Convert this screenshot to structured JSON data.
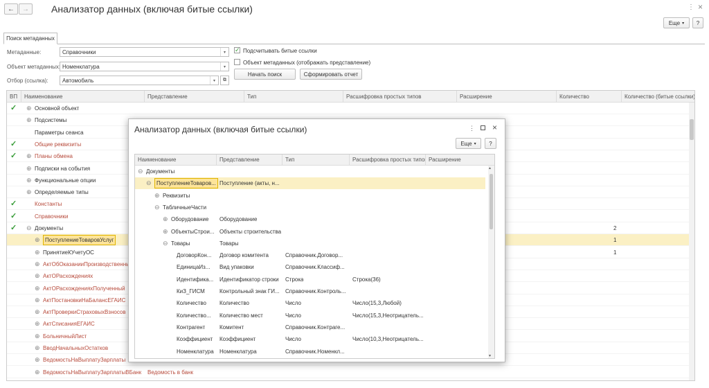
{
  "window": {
    "title": "Анализатор данных (включая битые ссылки)",
    "more_label": "Еще",
    "help_label": "?",
    "back_arrow": "←",
    "forward_arrow": "→",
    "dots": "⋮",
    "close": "×"
  },
  "tab": {
    "label": "Поиск метаданных"
  },
  "form": {
    "metadata_label": "Метаданные:",
    "metadata_value": "Справочники",
    "object_label": "Объект метаданных:",
    "object_value": "Номенклатура",
    "filter_label": "Отбор (ссылка):",
    "filter_value": "Автомобиль",
    "count_broken_label": "Подсчитывать битые ссылки",
    "count_broken_checked": true,
    "metadata_object_label": "Объект метаданных (отображать представление)",
    "metadata_object_checked": false,
    "search_button": "Начать поиск",
    "report_button": "Сформировать отчет"
  },
  "grid": {
    "headers": [
      "ВП",
      "Наименование",
      "Представление",
      "Тип",
      "Расшифровка простых типов",
      "Расширение",
      "Количество",
      "Количество (битые ссылки)"
    ],
    "rows": [
      {
        "check": true,
        "expander": "⊕",
        "indent": 1,
        "name": "Основной объект",
        "red": false,
        "count": ""
      },
      {
        "check": false,
        "expander": "⊕",
        "indent": 1,
        "name": "Подсистемы",
        "red": false,
        "count": ""
      },
      {
        "check": false,
        "expander": "",
        "indent": 1,
        "name": "Параметры сеанса",
        "red": false,
        "count": ""
      },
      {
        "check": true,
        "expander": "",
        "indent": 1,
        "name": "Общие реквизиты",
        "red": true,
        "count": ""
      },
      {
        "check": true,
        "expander": "⊕",
        "indent": 1,
        "name": "Планы обмена",
        "red": true,
        "count": ""
      },
      {
        "check": false,
        "expander": "⊕",
        "indent": 1,
        "name": "Подписки на события",
        "red": false,
        "count": ""
      },
      {
        "check": false,
        "expander": "⊕",
        "indent": 1,
        "name": "Функциональные опции",
        "red": false,
        "count": ""
      },
      {
        "check": false,
        "expander": "⊕",
        "indent": 1,
        "name": "Определяемые типы",
        "red": false,
        "count": ""
      },
      {
        "check": true,
        "expander": "",
        "indent": 1,
        "name": "Константы",
        "red": true,
        "count": ""
      },
      {
        "check": true,
        "expander": "",
        "indent": 1,
        "name": "Справочники",
        "red": true,
        "count": ""
      },
      {
        "check": true,
        "expander": "⊖",
        "indent": 1,
        "name": "Документы",
        "red": false,
        "count": "2"
      },
      {
        "check": false,
        "expander": "⊕",
        "indent": 2,
        "name": "ПоступлениеТоваровУслуг",
        "red": false,
        "count": "1",
        "selected": true
      },
      {
        "check": false,
        "expander": "⊕",
        "indent": 2,
        "name": "ПринятиеКУчетуОС",
        "red": false,
        "count": "1"
      },
      {
        "check": false,
        "expander": "⊕",
        "indent": 2,
        "name": "АктОбОказанииПроизводственныхУслуг",
        "red": true,
        "count": ""
      },
      {
        "check": false,
        "expander": "⊕",
        "indent": 2,
        "name": "АктОРасхождениях",
        "red": true,
        "count": ""
      },
      {
        "check": false,
        "expander": "⊕",
        "indent": 2,
        "name": "АктОРасхожденияхПолученный",
        "red": true,
        "count": ""
      },
      {
        "check": false,
        "expander": "⊕",
        "indent": 2,
        "name": "АктПостановкиНаБалансЕГАИС",
        "red": true,
        "count": ""
      },
      {
        "check": false,
        "expander": "⊕",
        "indent": 2,
        "name": "АктПроверкиСтраховыхВзносов",
        "red": true,
        "count": ""
      },
      {
        "check": false,
        "expander": "⊕",
        "indent": 2,
        "name": "АктСписанияЕГАИС",
        "red": true,
        "count": ""
      },
      {
        "check": false,
        "expander": "⊕",
        "indent": 2,
        "name": "БольничныйЛист",
        "red": true,
        "count": ""
      },
      {
        "check": false,
        "expander": "⊕",
        "indent": 2,
        "name": "ВводНачальныхОстатков",
        "red": true,
        "count": ""
      },
      {
        "check": false,
        "expander": "⊕",
        "indent": 2,
        "name": "ВедомостьНаВыплатуЗарплаты",
        "red": true,
        "count": ""
      },
      {
        "check": false,
        "expander": "⊕",
        "indent": 2,
        "name": "ВедомостьНаВыплатуЗарплатыВБанк",
        "red": true,
        "count": "",
        "repr": "Ведомость в банк"
      }
    ]
  },
  "modal": {
    "title": "Анализатор данных (включая битые ссылки)",
    "more_label": "Еще",
    "help_label": "?",
    "headers": [
      "Наименование",
      "Представление",
      "Тип",
      "Расшифровка простых типов",
      "Расширение"
    ],
    "rows": [
      {
        "expander": "⊖",
        "indent": 0,
        "name": "Документы",
        "repr": "",
        "type": "",
        "decode": ""
      },
      {
        "expander": "⊖",
        "indent": 1,
        "name": "ПоступлениеТоваров...",
        "repr": "Поступление (акты, н...",
        "type": "",
        "decode": "",
        "selected": true
      },
      {
        "expander": "⊕",
        "indent": 2,
        "name": "Реквизиты",
        "repr": "",
        "type": "",
        "decode": ""
      },
      {
        "expander": "⊖",
        "indent": 2,
        "name": "ТабличныеЧасти",
        "repr": "",
        "type": "",
        "decode": ""
      },
      {
        "expander": "⊕",
        "indent": 3,
        "name": "Оборудование",
        "repr": "Оборудование",
        "type": "",
        "decode": ""
      },
      {
        "expander": "⊕",
        "indent": 3,
        "name": "ОбъектыСтрои...",
        "repr": "Объекты строительства",
        "type": "",
        "decode": ""
      },
      {
        "expander": "⊖",
        "indent": 3,
        "name": "Товары",
        "repr": "Товары",
        "type": "",
        "decode": ""
      },
      {
        "expander": "",
        "indent": 4,
        "name": "ДоговорКон...",
        "repr": "Договор комитента",
        "type": "Справочник.Договор...",
        "decode": ""
      },
      {
        "expander": "",
        "indent": 4,
        "name": "ЕдиницаИз...",
        "repr": "Вид упаковки",
        "type": "Справочник.Классиф...",
        "decode": ""
      },
      {
        "expander": "",
        "indent": 4,
        "name": "Идентифика...",
        "repr": "Идентификатор строки",
        "type": "Строка",
        "decode": "Строка(36)"
      },
      {
        "expander": "",
        "indent": 4,
        "name": "КиЗ_ГИСМ",
        "repr": "Контрольный знак ГИ...",
        "type": "Справочник.Контроль...",
        "decode": ""
      },
      {
        "expander": "",
        "indent": 4,
        "name": "Количество",
        "repr": "Количество",
        "type": "Число",
        "decode": "Число(15,3,Любой)"
      },
      {
        "expander": "",
        "indent": 4,
        "name": "Количество...",
        "repr": "Количество мест",
        "type": "Число",
        "decode": "Число(15,3,Неотрицатель..."
      },
      {
        "expander": "",
        "indent": 4,
        "name": "Контрагент",
        "repr": "Комитент",
        "type": "Справочник.Контраге...",
        "decode": ""
      },
      {
        "expander": "",
        "indent": 4,
        "name": "Коэффициент",
        "repr": "Коэффициент",
        "type": "Число",
        "decode": "Число(10,3,Неотрицатель..."
      },
      {
        "expander": "",
        "indent": 4,
        "name": "Номенклатура",
        "repr": "Номенклатура",
        "type": "Справочник.Номенкл...",
        "decode": ""
      }
    ]
  },
  "colors": {
    "selection": "#fbf0c4",
    "check": "#3a9d3a",
    "broken": "#b74a3b"
  }
}
